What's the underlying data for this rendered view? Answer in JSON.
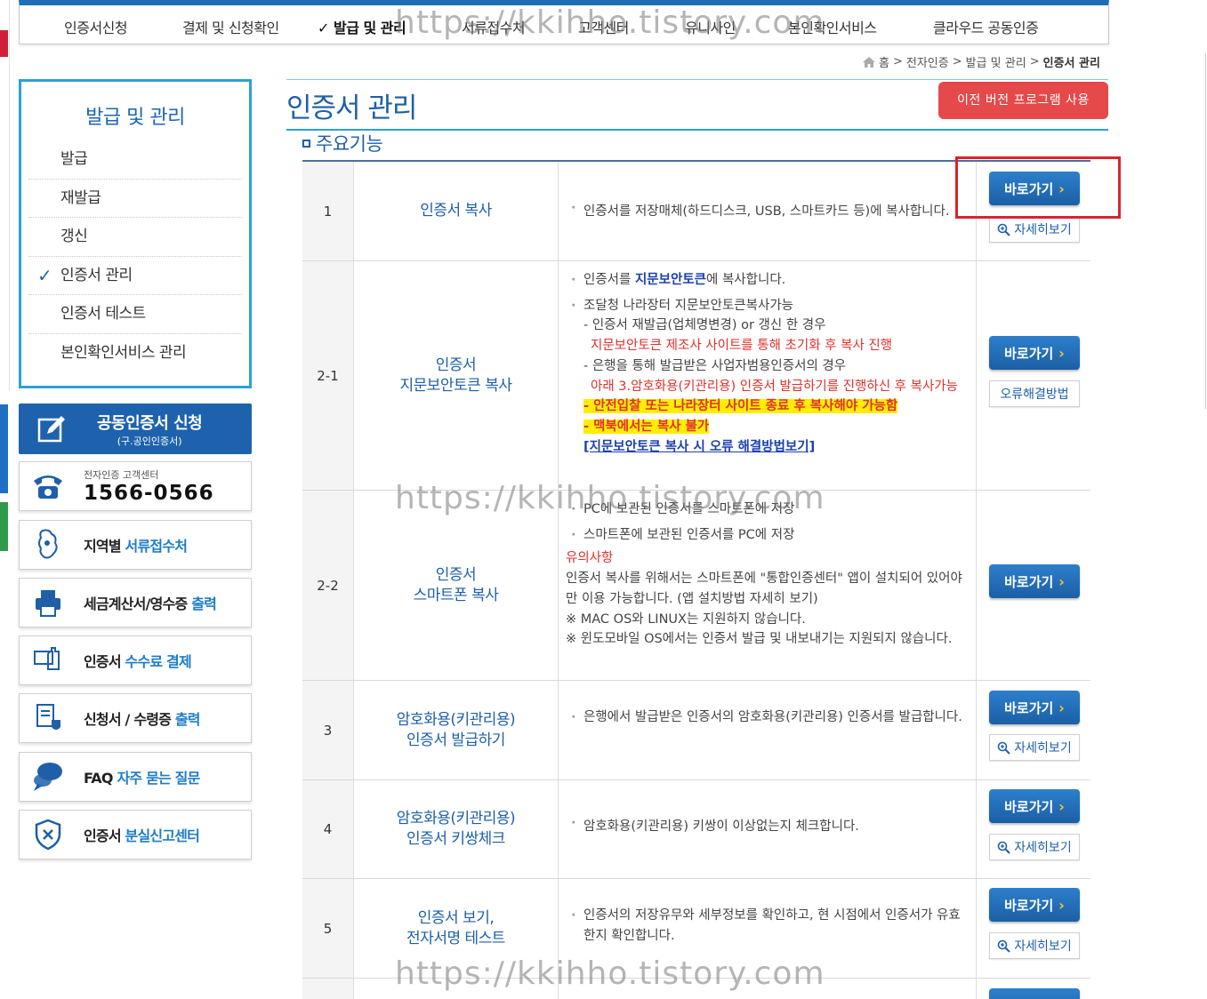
{
  "topnav": {
    "items": [
      {
        "label": "인증서신청",
        "active": false
      },
      {
        "label": "결제 및 신청확인",
        "active": false
      },
      {
        "label": "✓ 발급 및 관리",
        "active": true
      },
      {
        "label": "서류접수처",
        "active": false
      },
      {
        "label": "고객센터",
        "active": false
      },
      {
        "label": "유니사인",
        "active": false
      },
      {
        "label": "본인확인서비스",
        "active": false
      },
      {
        "label": "클라우드 공동인증",
        "active": false
      }
    ]
  },
  "breadcrumb": {
    "home": "홈",
    "sep": ">",
    "items": [
      "전자인증",
      "발급 및 관리",
      "인증서 관리"
    ]
  },
  "sidebar": {
    "title": "발급 및 관리",
    "items": [
      {
        "label": "발급",
        "checked": false
      },
      {
        "label": "재발급",
        "checked": false
      },
      {
        "label": "갱신",
        "checked": false
      },
      {
        "label": "인증서 관리",
        "checked": true
      },
      {
        "label": "인증서 테스트",
        "checked": false
      },
      {
        "label": "본인확인서비스 관리",
        "checked": false
      }
    ],
    "check_glyph": "✓",
    "apply": {
      "title": "공동인증서 신청",
      "sub": "(구.공인인증서)"
    },
    "phone": {
      "caption": "전자인증 고객센터",
      "number": "1566-0566"
    },
    "boxes": [
      {
        "main": "지역별 ",
        "hl": "서류접수처",
        "icon": "map-icon"
      },
      {
        "main": "세금계산서/영수증 ",
        "hl": "출력",
        "icon": "printer-icon"
      },
      {
        "main": "인증서 ",
        "hl": "수수료 결제",
        "icon": "payment-icon"
      },
      {
        "main": "신청서 / 수령증 ",
        "hl": "출력",
        "icon": "document-icon"
      },
      {
        "main": "FAQ ",
        "hl": "자주 묻는 질문",
        "icon": "chat-icon"
      },
      {
        "main": "인증서 ",
        "hl": "분실신고센터",
        "icon": "shield-icon"
      }
    ]
  },
  "main": {
    "title": "인증서 관리",
    "prev_button": "이전 버전 프로그램 사용",
    "section": "주요기능",
    "go_label": "바로가기",
    "go_arrow": "›",
    "detail_label": "자세히보기",
    "error_label": "오류해결방법"
  },
  "rows": [
    {
      "num": "1",
      "name": [
        "인증서 복사"
      ],
      "desc": "인증서를 저장매체(하드디스크, USB, 스마트카드 등)에 복사합니다."
    },
    {
      "num": "2-1",
      "name": [
        "인증서",
        "지문보안토큰 복사"
      ],
      "d1a": "인증서를 ",
      "d1b": "지문보안토큰",
      "d1c": "에 복사합니다.",
      "d2": "조달청 나라장터 지문보안토큰복사가능",
      "d3": "- 인증서 재발급(업체명변경) or 갱신 한 경우",
      "d4": "지문보안토큰 제조사 사이트를 통해 초기화 후 복사 진행",
      "d5": "- 은행을 통해 발급받은 사업자범용인증서의 경우",
      "d6": "아래 3.암호화용(키관리용) 인증서 발급하기를 진행하신 후 복사가능",
      "d7": "- 안전입찰 또는 나라장터 사이트 종료 후 복사해야 가능함",
      "d8": "- 맥북에서는 복사 불가",
      "d9": "[지문보안토큰 복사 시 오류 해결방법보기]"
    },
    {
      "num": "2-2",
      "name": [
        "인증서",
        "스마트폰 복사"
      ],
      "d1": "PC에 보관된 인증서를 스마트폰에 저장",
      "d2": "스마트폰에 보관된 인증서를 PC에 저장",
      "d3": "유의사항",
      "d4": "인증서 복사를 위해서는 스마트폰에 \"통합인증센터\" 앱이 설치되어 있어야만 이용 가능합니다. (앱 설치방법 자세히 보기)",
      "d5": "※ MAC OS와 LINUX는 지원하지 않습니다.",
      "d6": "※ 윈도모바일 OS에서는 인증서 발급 및 내보내기는 지원되지 않습니다."
    },
    {
      "num": "3",
      "name": [
        "암호화용(키관리용)",
        "인증서 발급하기"
      ],
      "desc": "은행에서 발급받은 인증서의 암호화용(키관리용) 인증서를 발급합니다."
    },
    {
      "num": "4",
      "name": [
        "암호화용(키관리용)",
        "인증서 키쌍체크"
      ],
      "desc": "암호화용(키관리용) 키쌍이 이상없는지 체크합니다."
    },
    {
      "num": "5",
      "name": [
        "인증서 보기,",
        "전자서명 테스트"
      ],
      "desc": "인증서의 저장유무와 세부정보를 확인하고, 현 시점에서 인증서가 유효한지 확인합니다."
    }
  ],
  "watermark": "https://kkihho.tistory.com",
  "colors": {
    "brand_blue": "#1e5fa8",
    "accent_cyan": "#2aa1d8",
    "alert_red": "#e5494a",
    "highlight_box": "#d9242e"
  }
}
